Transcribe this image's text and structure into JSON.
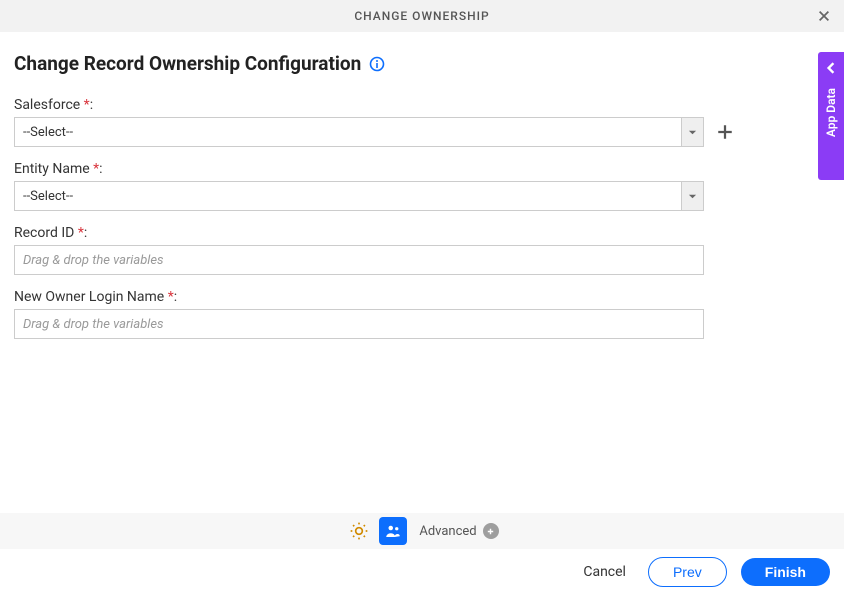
{
  "header": {
    "title": "CHANGE OWNERSHIP"
  },
  "page_title": "Change Record Ownership Configuration",
  "fields": {
    "salesforce": {
      "label": "Salesforce",
      "selected": "--Select--"
    },
    "entity_name": {
      "label": "Entity Name",
      "selected": "--Select--"
    },
    "record_id": {
      "label": "Record ID",
      "placeholder": "Drag & drop the variables"
    },
    "new_owner": {
      "label": "New Owner Login Name",
      "placeholder": "Drag & drop the variables"
    }
  },
  "side_tab": {
    "label": "App Data"
  },
  "toolbar": {
    "advanced_label": "Advanced"
  },
  "footer": {
    "cancel": "Cancel",
    "prev": "Prev",
    "finish": "Finish"
  },
  "punct": {
    "required": " *",
    "colon": ":"
  }
}
